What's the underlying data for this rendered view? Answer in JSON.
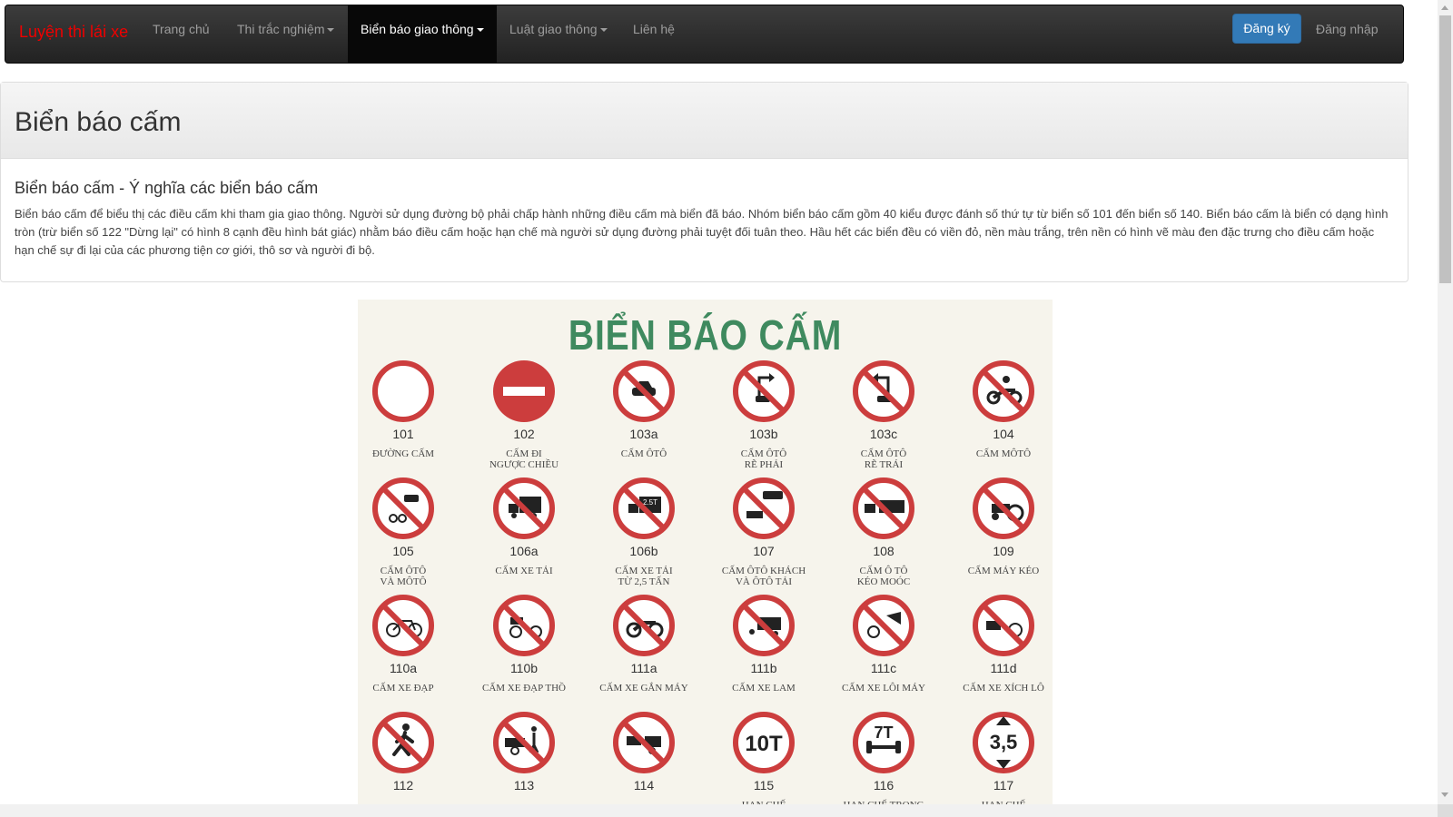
{
  "nav": {
    "brand": "Luyện thi lái xe",
    "items": [
      {
        "label": "Trang chủ"
      },
      {
        "label": "Thi trắc nghiệm"
      },
      {
        "label": "Biển báo giao thông"
      },
      {
        "label": "Luật giao thông"
      },
      {
        "label": "Liên hệ"
      }
    ],
    "register": "Đăng ký",
    "login": "Đăng nhập"
  },
  "panel": {
    "title": "Biển báo cấm",
    "subtitle": "Biển báo cấm - Ý nghĩa các biển báo cấm",
    "description": "Biển báo cấm để biểu thị các điều cấm khi tham gia giao thông. Người sử dụng đường bộ phải chấp hành những điều cấm mà biển đã báo. Nhóm biển báo cấm gồm 40 kiểu được đánh số thứ tự từ biển số 101 đến biển số 140. Biển báo cấm là biển có dạng hình tròn (trừ biển số 122 \"Dừng lại\" có hình 8 cạnh đều hình bát giác) nhằm báo điều cấm hoặc hạn chế mà người sử dụng đường phải tuyệt đối tuân theo. Hầu hết các biển đều có viền đỏ, nền màu trắng, trên nền có hình vẽ màu đen đặc trưng cho điều cấm hoặc hạn chế sự đi lại của các phương tiện cơ giới, thô sơ và người đi bộ."
  },
  "board": {
    "title": "BIỂN BÁO CẤM",
    "signs": [
      {
        "code": "101",
        "name": "Đường cấm",
        "icon": "empty-circle-icon"
      },
      {
        "code": "102",
        "name": "Cấm đi\nngược chiều",
        "icon": "no-entry-icon"
      },
      {
        "code": "103a",
        "name": "Cấm ôtô",
        "icon": "no-car-icon"
      },
      {
        "code": "103b",
        "name": "Cấm ôtô\nrẽ phải",
        "icon": "no-right-turn-icon"
      },
      {
        "code": "103c",
        "name": "Cấm ôtô\nrẽ trái",
        "icon": "no-left-turn-icon"
      },
      {
        "code": "104",
        "name": "Cấm môtô",
        "icon": "no-motorbike-icon"
      },
      {
        "code": "105",
        "name": "Cấm ôtô\nvà môtô",
        "icon": "no-car-motorbike-icon"
      },
      {
        "code": "106a",
        "name": "Cấm xe tải",
        "icon": "no-truck-icon"
      },
      {
        "code": "106b",
        "name": "Cấm xe tải\ntừ 2,5 tấn",
        "icon": "no-truck-weight-icon"
      },
      {
        "code": "107",
        "name": "Cấm ôtô khách\nvà ôtô tải",
        "icon": "no-bus-truck-icon"
      },
      {
        "code": "108",
        "name": "Cấm ô tô\nkéo moóc",
        "icon": "no-trailer-icon"
      },
      {
        "code": "109",
        "name": "Cấm máy kéo",
        "icon": "no-tractor-icon"
      },
      {
        "code": "110a",
        "name": "Cấm xe đạp",
        "icon": "no-bicycle-icon"
      },
      {
        "code": "110b",
        "name": "Cấm xe đạp thồ",
        "icon": "no-cargo-bicycle-icon"
      },
      {
        "code": "111a",
        "name": "Cấm xe gắn máy",
        "icon": "no-moped-icon"
      },
      {
        "code": "111b",
        "name": "Cấm xe lam",
        "icon": "no-three-wheeler-icon"
      },
      {
        "code": "111c",
        "name": "Cấm xe lôi máy",
        "icon": "no-motor-rickshaw-icon"
      },
      {
        "code": "111d",
        "name": "Cấm xe xích lô",
        "icon": "no-cyclo-icon"
      },
      {
        "code": "112",
        "name": "",
        "icon": "no-pedestrian-icon"
      },
      {
        "code": "113",
        "name": "",
        "icon": "no-handcart-icon"
      },
      {
        "code": "114",
        "name": "",
        "icon": "no-animal-cart-icon"
      },
      {
        "code": "115",
        "name": "Hạn chế",
        "icon": "weight-limit-icon",
        "inner": "10T"
      },
      {
        "code": "116",
        "name": "Hạn chế trọng",
        "icon": "axle-limit-icon",
        "inner": "7T"
      },
      {
        "code": "117",
        "name": "Hạn chế",
        "icon": "height-limit-icon",
        "inner": "3,5"
      }
    ]
  },
  "colors": {
    "brand": "#ee0000",
    "primary": "#337ab7",
    "sign_red": "#cc3d3d",
    "board_title": "#3f8a5f"
  }
}
